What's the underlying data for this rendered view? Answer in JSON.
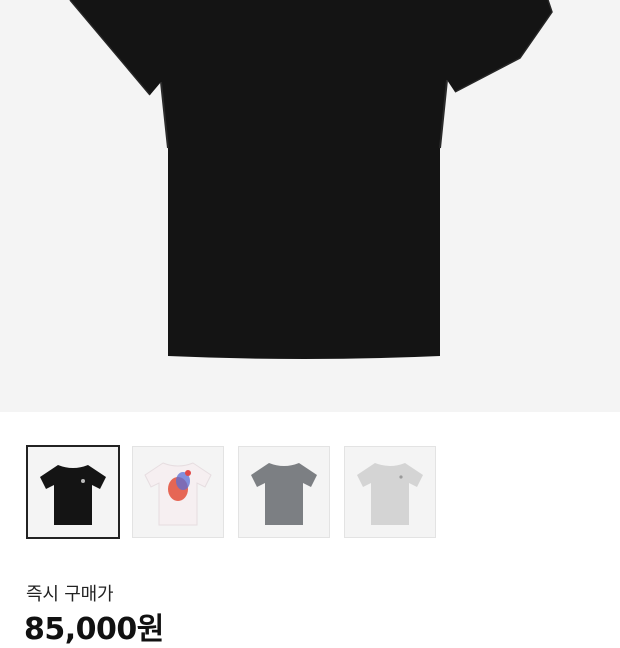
{
  "product": {
    "main_image": "black-t-shirt",
    "thumbnails": [
      {
        "name": "black-t-shirt",
        "color": "#141414",
        "selected": true
      },
      {
        "name": "white-graphic-t-shirt",
        "color": "#f3ecee",
        "selected": false
      },
      {
        "name": "gray-t-shirt",
        "color": "#7c7f83",
        "selected": false
      },
      {
        "name": "light-gray-t-shirt",
        "color": "#d4d4d4",
        "selected": false
      }
    ]
  },
  "purchase": {
    "instant_label": "즉시 구매가",
    "price": "85,000원"
  },
  "colors": {
    "hero_bg": "#f4f4f4",
    "selected_border": "#222222"
  }
}
